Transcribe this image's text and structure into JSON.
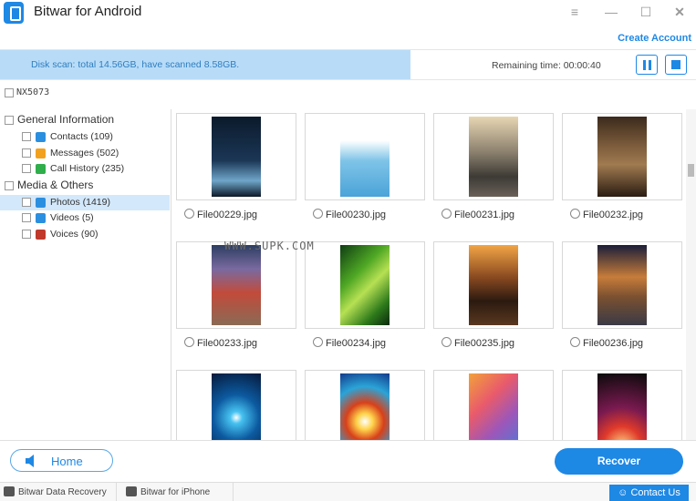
{
  "window": {
    "title": "Bitwar for Android",
    "controls": [
      "menu-icon",
      "minimize-icon",
      "maximize-icon",
      "close-icon"
    ]
  },
  "header": {
    "create_account": "Create Account"
  },
  "scan": {
    "status": "Disk scan: total 14.56GB, have scanned 8.58GB.",
    "remaining": "Remaining time: 00:00:40",
    "progress": 0.59
  },
  "device": {
    "name": "NX5073"
  },
  "tree": {
    "groups": [
      {
        "label": "General Information",
        "items": [
          {
            "label": "Contacts (109)",
            "icon": "contacts-icon",
            "color": "#2b8fe0"
          },
          {
            "label": "Messages (502)",
            "icon": "messages-icon",
            "color": "#f2a11f"
          },
          {
            "label": "Call History (235)",
            "icon": "call-icon",
            "color": "#2fae4b"
          }
        ]
      },
      {
        "label": "Media & Others",
        "items": [
          {
            "label": "Photos (1419)",
            "icon": "photos-icon",
            "color": "#2b8fe0",
            "selected": true
          },
          {
            "label": "Videos (5)",
            "icon": "videos-icon",
            "color": "#2b8fe0"
          },
          {
            "label": "Voices (90)",
            "icon": "voices-icon",
            "color": "#c0392b"
          }
        ]
      }
    ]
  },
  "files": [
    {
      "name": "File00229.jpg"
    },
    {
      "name": "File00230.jpg"
    },
    {
      "name": "File00231.jpg"
    },
    {
      "name": "File00232.jpg"
    },
    {
      "name": "File00233.jpg"
    },
    {
      "name": "File00234.jpg"
    },
    {
      "name": "File00235.jpg"
    },
    {
      "name": "File00236.jpg"
    },
    {
      "name": ""
    },
    {
      "name": ""
    },
    {
      "name": ""
    },
    {
      "name": ""
    }
  ],
  "watermark": "WWW.SUPK.COM",
  "bottom": {
    "home": "Home",
    "recover": "Recover"
  },
  "footer": {
    "tab1": "Bitwar Data Recovery",
    "tab2": "Bitwar for iPhone",
    "contact": "Contact Us"
  },
  "colors": {
    "accent": "#1e88e5",
    "progress": "#b8dcf8"
  }
}
